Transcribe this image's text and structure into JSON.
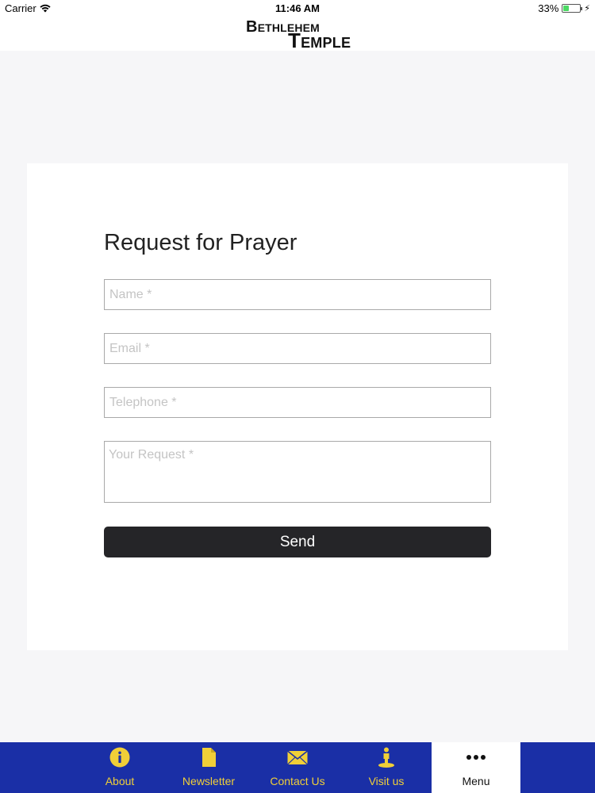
{
  "status_bar": {
    "carrier": "Carrier",
    "time": "11:46 AM",
    "battery_text": "33%",
    "battery_level": 0.33
  },
  "header": {
    "logo_line1_first": "B",
    "logo_line1_rest": "ETHLEHEM",
    "logo_line2_first": "T",
    "logo_line2_rest": "EMPLE"
  },
  "form": {
    "title": "Request for Prayer",
    "name_placeholder": "Name *",
    "email_placeholder": "Email *",
    "telephone_placeholder": "Telephone *",
    "request_placeholder": "Your Request *",
    "send_label": "Send"
  },
  "tabs": [
    {
      "label": "About",
      "icon": "info-icon"
    },
    {
      "label": "Newsletter",
      "icon": "document-icon"
    },
    {
      "label": "Contact Us",
      "icon": "envelope-icon"
    },
    {
      "label": "Visit us",
      "icon": "visitor-icon"
    },
    {
      "label": "Menu",
      "icon": "more-icon"
    }
  ],
  "colors": {
    "tab_bar": "#1a2fa6",
    "tab_accent": "#f0cf38",
    "send_button": "#252528",
    "background": "#f6f6f8"
  }
}
